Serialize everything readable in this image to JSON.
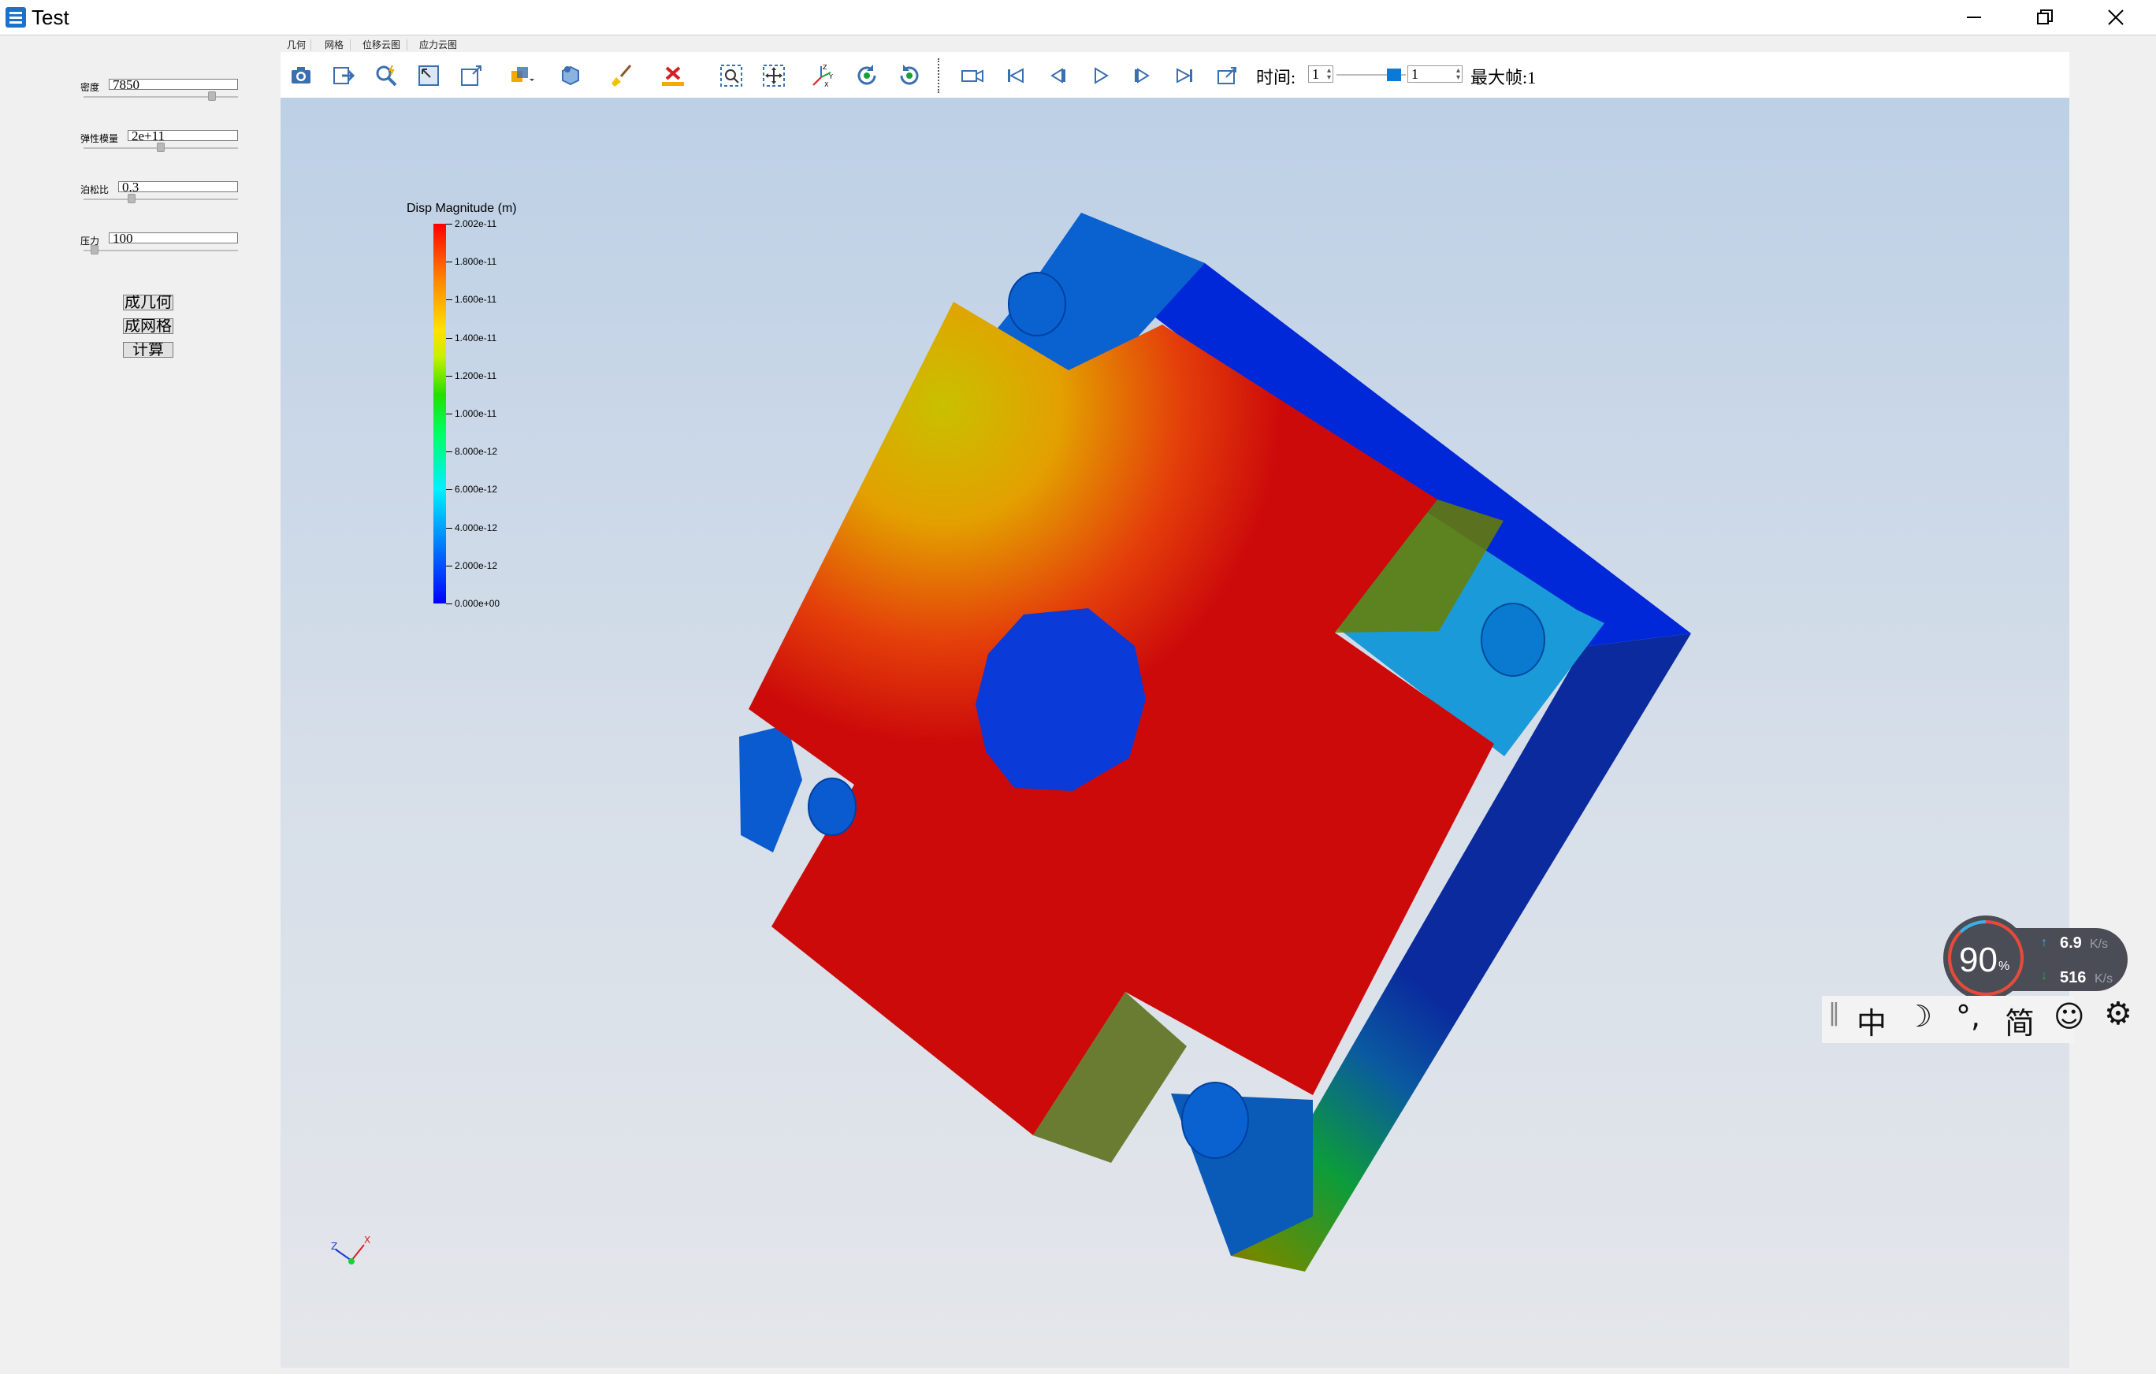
{
  "window": {
    "title": "Test"
  },
  "params": [
    {
      "label": "密度",
      "value": "7850",
      "level": 0.85
    },
    {
      "label": "弹性模量",
      "value": "2e+11",
      "level": 0.5
    },
    {
      "label": "泊松比",
      "value": "0.3",
      "level": 0.3
    },
    {
      "label": "压力",
      "value": "100",
      "level": 0.05
    }
  ],
  "actions": {
    "geometry": "成几何",
    "mesh": "成网格",
    "compute": "计算"
  },
  "tabs": [
    "几何",
    "网格",
    "位移云图",
    "应力云图"
  ],
  "toolbar": {
    "icons": [
      "camera-icon",
      "export-icon",
      "zoom-icon",
      "fit-view-icon",
      "view-box-icon",
      "color-map-icon",
      "cube-icon",
      "brush-icon",
      "delete-icon",
      "zoom-box-icon",
      "pan-icon",
      "axes-icon",
      "rotate-cw-icon",
      "rotate-ccw-icon",
      "record-icon",
      "first-frame-icon",
      "prev-frame-icon",
      "play-icon",
      "next-frame-icon",
      "last-frame-icon",
      "export-anim-icon"
    ],
    "time_label": "时间:",
    "time_value": "1",
    "frame_value": "1",
    "max_frame_label": "最大帧:1"
  },
  "legend": {
    "title": "Disp Magnitude (m)",
    "labels": [
      "2.002e-11",
      "1.800e-11",
      "1.600e-11",
      "1.400e-11",
      "1.200e-11",
      "1.000e-11",
      "8.000e-12",
      "6.000e-12",
      "4.000e-12",
      "2.000e-12",
      "0.000e+00"
    ]
  },
  "axes": {
    "x": "X",
    "y": "Y",
    "z": "Z"
  },
  "netmon": {
    "percent": "90",
    "unit": "%",
    "up": "6.9",
    "down": "516",
    "rate_unit": "K/s"
  },
  "ime": {
    "lang": "中",
    "punct": "°,",
    "mode": "简"
  }
}
